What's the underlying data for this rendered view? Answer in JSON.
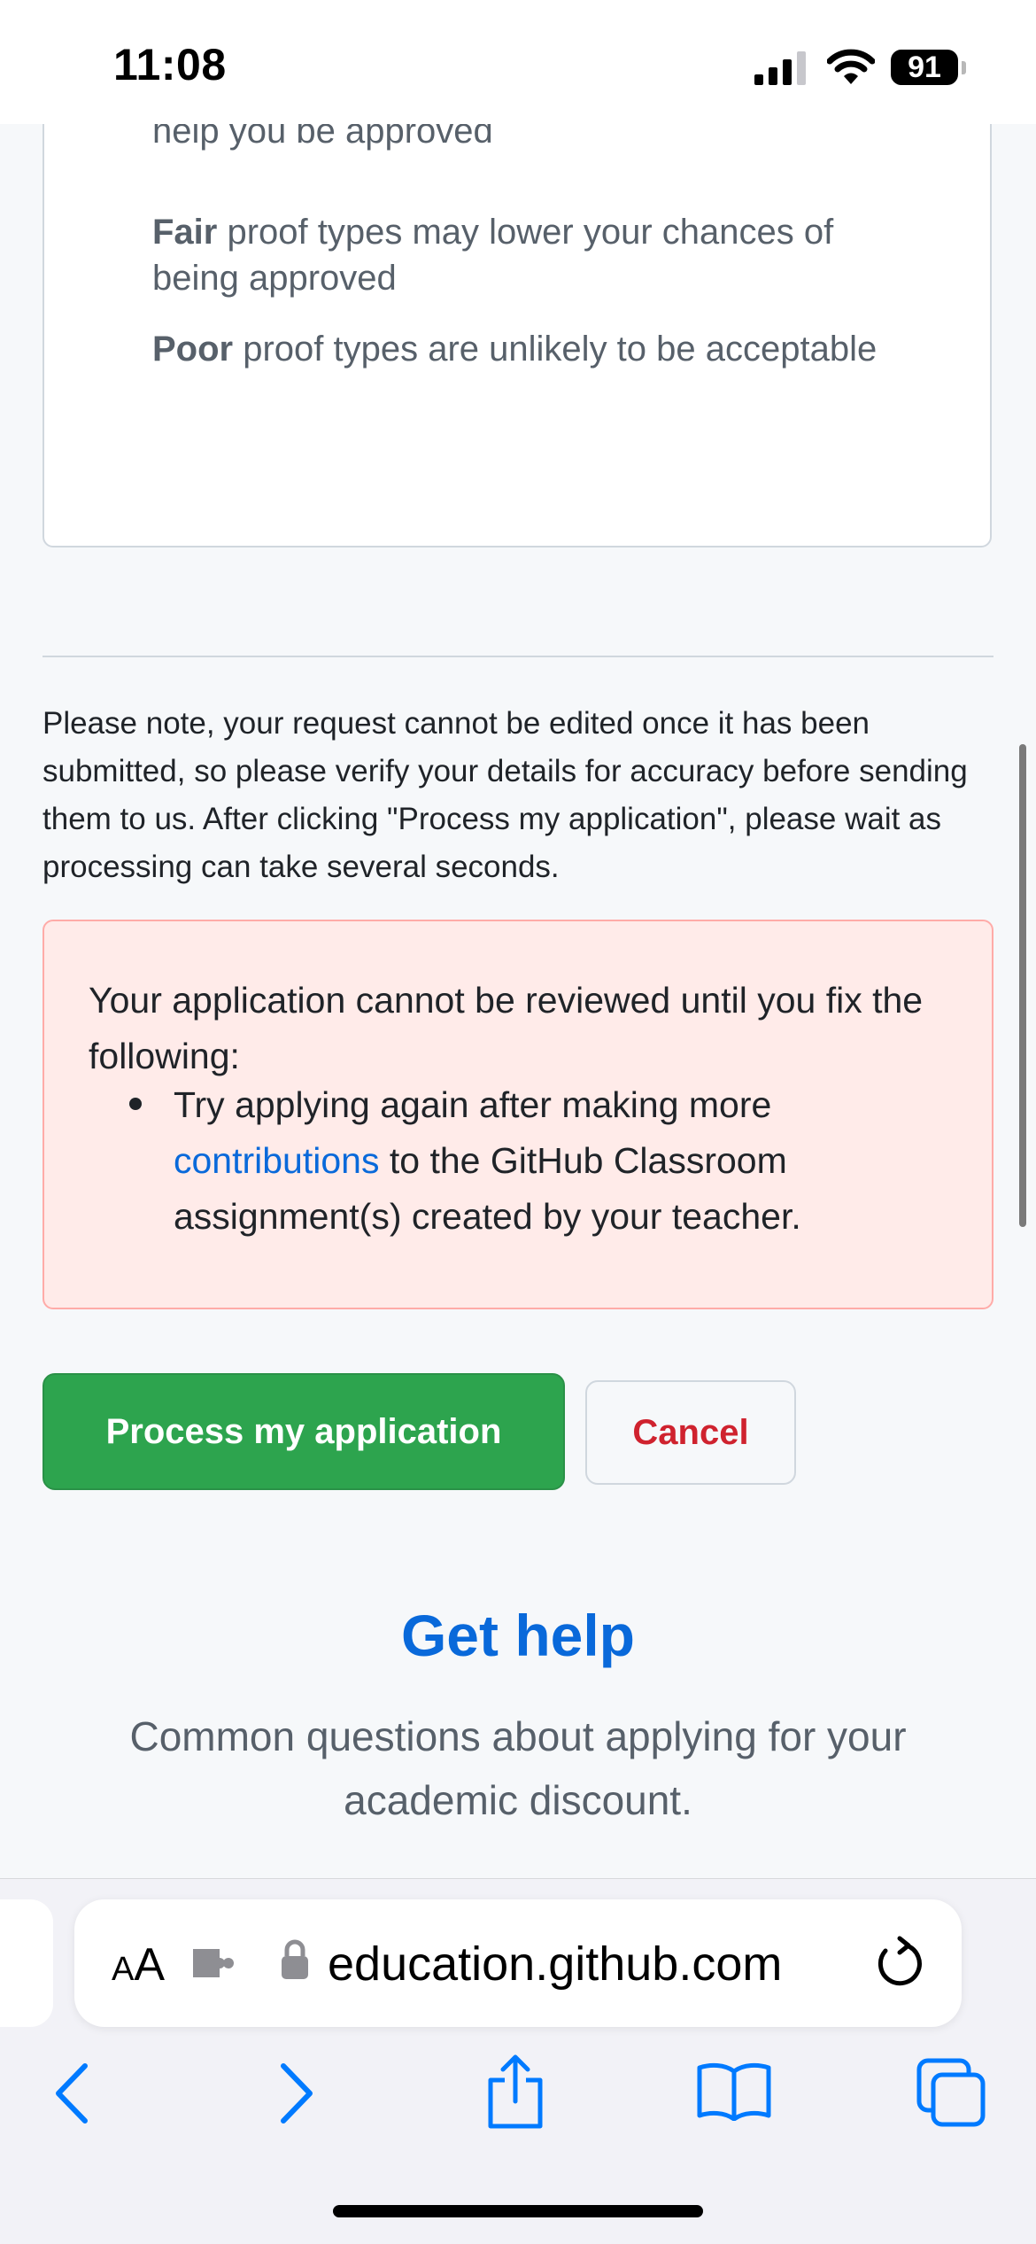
{
  "status_bar": {
    "time": "11:08",
    "battery": "91"
  },
  "legend": {
    "good_text": "help you be approved",
    "fair_label": "Fair",
    "fair_text": " proof types may lower your chances of being approved",
    "poor_label": "Poor",
    "poor_text": " proof types are unlikely to be acceptable"
  },
  "note": "Please note, your request cannot be edited once it has been submitted, so please verify your details for accuracy before sending them to us. After clicking \"Process my application\", please wait as processing can take several seconds.",
  "error": {
    "heading": "Your application cannot be reviewed until you fix the following:",
    "item_prefix": "Try applying again after making more ",
    "item_link": "contributions",
    "item_suffix": " to the GitHub Classroom assignment(s) created by your teacher."
  },
  "buttons": {
    "process": "Process my application",
    "cancel": "Cancel"
  },
  "help": {
    "title": "Get help",
    "subtitle": "Common questions about applying for your academic discount."
  },
  "browser": {
    "aa_label_small": "A",
    "aa_label_large": "A",
    "url": "education.github.com"
  },
  "colors": {
    "primary_green": "#2da44e",
    "danger_red": "#cf222e",
    "link_blue": "#0969da",
    "error_bg": "#ffebe9",
    "ios_blue": "#007aff"
  },
  "icons": [
    "signal-icon",
    "wifi-icon",
    "battery-icon",
    "extension-icon",
    "lock-icon",
    "reload-icon",
    "back-icon",
    "forward-icon",
    "share-icon",
    "bookmarks-icon",
    "tabs-icon"
  ]
}
